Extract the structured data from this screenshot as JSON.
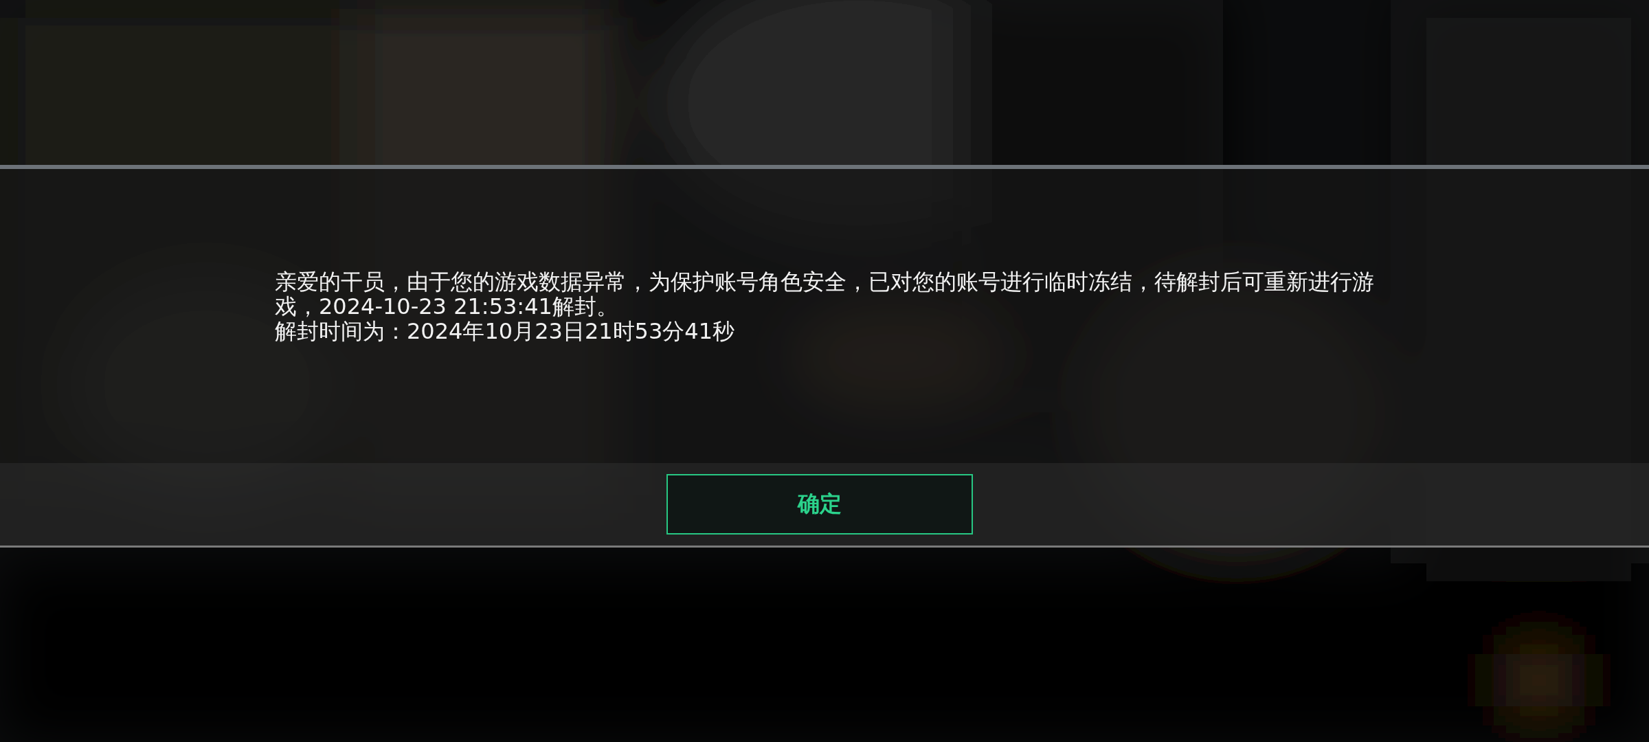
{
  "dialog": {
    "message": "亲爱的干员，由于您的游戏数据异常，为保护账号角色安全，已对您的账号进行临时冻结，待解封后可重新进行游戏，2024-10-23 21:53:41解封。",
    "unlock_time": "解封时间为：2024年10月23日21时53分41秒",
    "button": "确定"
  }
}
